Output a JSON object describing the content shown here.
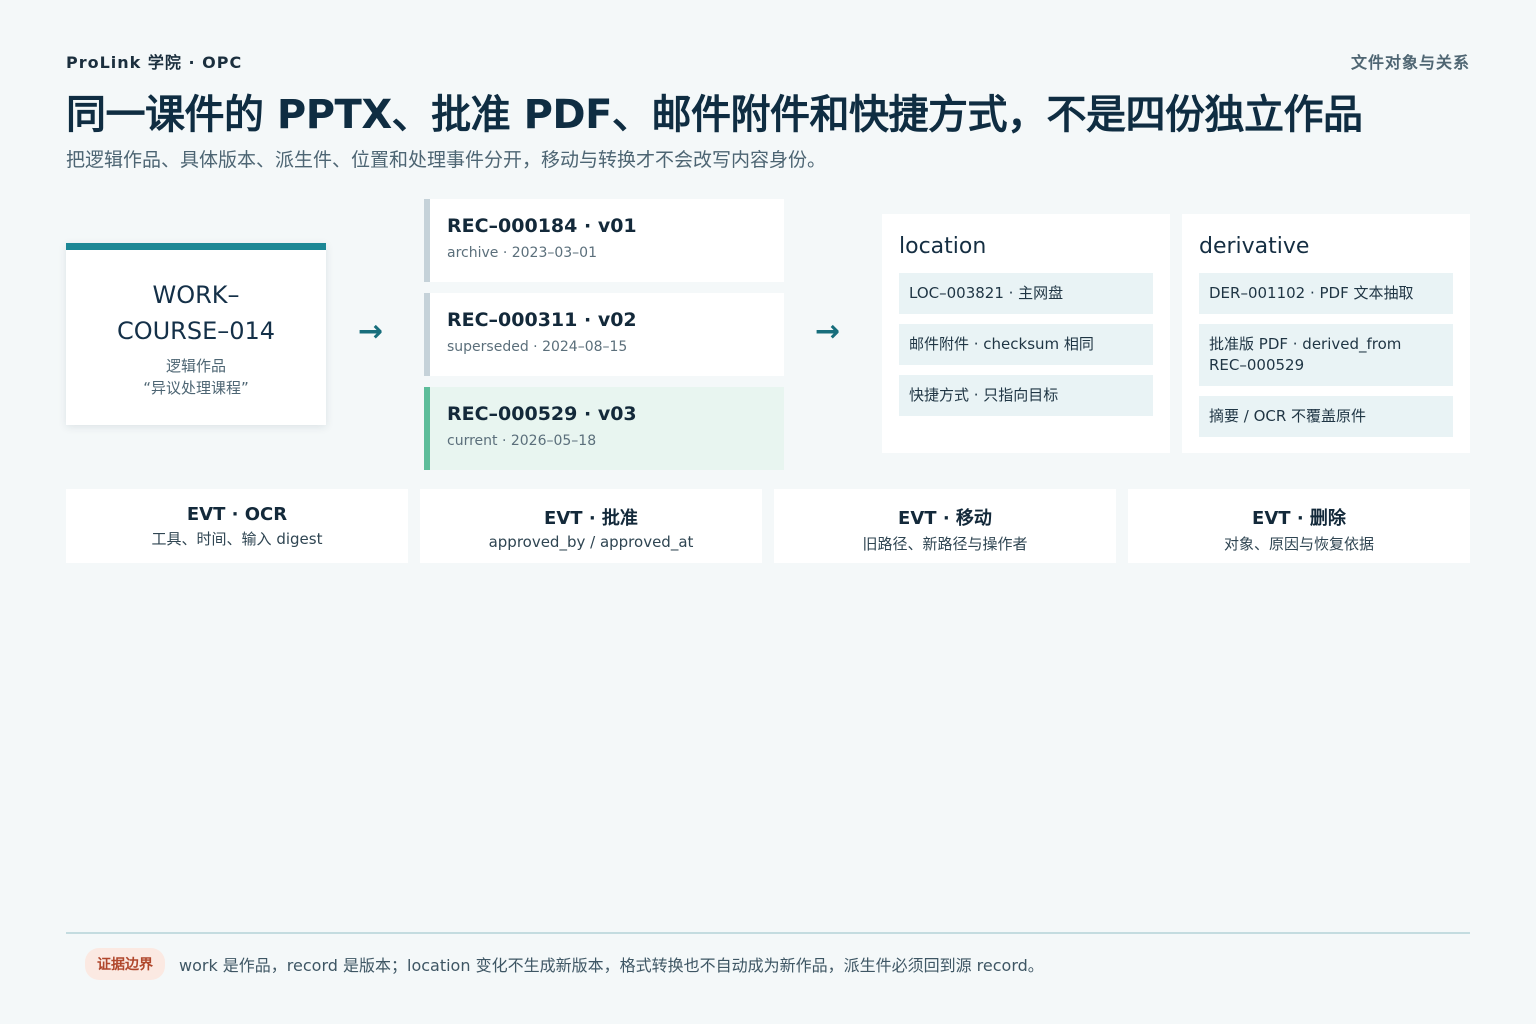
{
  "header": {
    "brand": "ProLink 学院 · OPC",
    "section_label": "文件对象与关系",
    "title": "同一课件的 PPTX、批准 PDF、邮件附件和快捷方式，不是四份独立作品",
    "subtitle": "把逻辑作品、具体版本、派生件、位置和处理事件分开，移动与转换才不会改写内容身份。"
  },
  "work": {
    "id": "WORK–COURSE–014",
    "type": "逻辑作品",
    "name": "“异议处理课程”"
  },
  "arrows": {
    "symbol": "→"
  },
  "records": [
    {
      "title": "REC–000184 · v01",
      "meta": "archive · 2023–03–01",
      "status": "archive"
    },
    {
      "title": "REC–000311 · v02",
      "meta": "superseded · 2024–08–15",
      "status": "superseded"
    },
    {
      "title": "REC–000529 · v03",
      "meta": "current · 2026–05–18",
      "status": "current"
    }
  ],
  "location_panel": {
    "title": "location",
    "items": [
      "LOC–003821 · 主网盘",
      "邮件附件 · checksum 相同",
      "快捷方式 · 只指向目标"
    ]
  },
  "derivative_panel": {
    "title": "derivative",
    "items": [
      "DER–001102 · PDF 文本抽取",
      "批准版 PDF · derived_from REC–000529",
      "摘要 / OCR 不覆盖原件"
    ]
  },
  "events": [
    {
      "title": "EVT · OCR",
      "desc": "工具、时间、输入 digest"
    },
    {
      "title": "EVT · 批准",
      "desc": "approved_by / approved_at"
    },
    {
      "title": "EVT · 移动",
      "desc": "旧路径、新路径与操作者"
    },
    {
      "title": "EVT · 删除",
      "desc": "对象、原因与恢复依据"
    }
  ],
  "footer": {
    "badge": "证据边界",
    "text": "work 是作品，record 是版本；location 变化不生成新版本，格式转换也不自动成为新作品，派生件必须回到源 record。"
  },
  "colors": {
    "accent_teal": "#1c8795",
    "current_green": "#5dbd9a",
    "badge_red": "#b0472c"
  }
}
